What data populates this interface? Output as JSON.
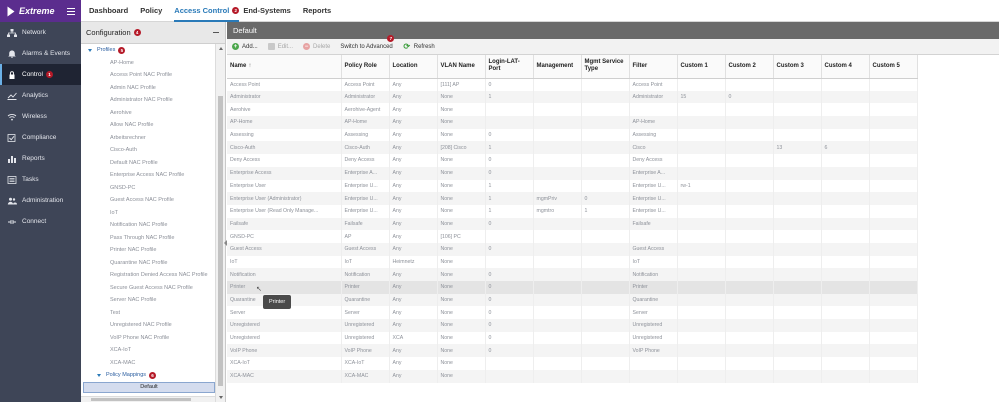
{
  "brand": {
    "name": "Extreme"
  },
  "sidebar": {
    "items": [
      {
        "label": "Network",
        "icon": "network-icon"
      },
      {
        "label": "Alarms & Events",
        "icon": "bell-icon"
      },
      {
        "label": "Control",
        "icon": "lock-icon",
        "badge": "1",
        "active": true
      },
      {
        "label": "Analytics",
        "icon": "chart-icon"
      },
      {
        "label": "Wireless",
        "icon": "wifi-icon"
      },
      {
        "label": "Compliance",
        "icon": "checkmark-icon"
      },
      {
        "label": "Reports",
        "icon": "bar-chart-icon"
      },
      {
        "label": "Tasks",
        "icon": "list-icon"
      },
      {
        "label": "Administration",
        "icon": "users-icon"
      },
      {
        "label": "Connect",
        "icon": "connect-icon"
      }
    ]
  },
  "topnav": {
    "tabs": [
      {
        "label": "Dashboard"
      },
      {
        "label": "Policy"
      },
      {
        "label": "Access Control",
        "active": true,
        "badge": "2"
      },
      {
        "label": "End-Systems"
      },
      {
        "label": "Reports"
      }
    ]
  },
  "tree": {
    "header": "Configuration",
    "header_badge": "4",
    "profiles_label": "Profiles",
    "profiles_badge": "5",
    "profiles": [
      "AP-Home",
      "Access Point NAC Profile",
      "Admin NAC Profile",
      "Administrator NAC Profile",
      "Aerohive",
      "Allow NAC Profile",
      "Arbeitsrechner",
      "Cisco-Auth",
      "Default NAC Profile",
      "Enterprise Access NAC Profile",
      "GNSD-PC",
      "Guest Access NAC Profile",
      "IoT",
      "Notification NAC Profile",
      "Pass Through NAC Profile",
      "Printer NAC Profile",
      "Quarantine NAC Profile",
      "Registration Denied Access NAC Profile",
      "Secure Guest Access NAC Profile",
      "Server NAC Profile",
      "Test",
      "Unregistered NAC Profile",
      "VoIP Phone NAC Profile",
      "XCA-IoT",
      "XCA-MAC"
    ],
    "mappings_label": "Policy Mappings",
    "mappings_badge": "6",
    "selected": "Default"
  },
  "main": {
    "title": "Default",
    "toolbar": {
      "add": "Add...",
      "edit": "Edit...",
      "delete": "Delete",
      "switch": "Switch to Advanced",
      "switch_badge": "7",
      "refresh": "Refresh"
    },
    "columns": [
      "Name",
      "Policy Role",
      "Location",
      "VLAN Name",
      "Login-LAT-Port",
      "Management",
      "Mgmt Service Type",
      "Filter",
      "Custom 1",
      "Custom 2",
      "Custom 3",
      "Custom 4",
      "Custom 5"
    ],
    "sort_indicator": "↑",
    "rows": [
      [
        "Access Point",
        "Access Point",
        "Any",
        "[111] AP",
        "0",
        "",
        "",
        "Access Point",
        "",
        "",
        "",
        "",
        ""
      ],
      [
        "Administrator",
        "Administrator",
        "Any",
        "None",
        "1",
        "",
        "",
        "Administrator",
        "15",
        "0",
        "",
        "",
        ""
      ],
      [
        "Aerohive",
        "Aerohive-Agent",
        "Any",
        "None",
        "",
        "",
        "",
        "",
        "",
        "",
        "",
        "",
        ""
      ],
      [
        "AP-Home",
        "AP-Home",
        "Any",
        "None",
        "",
        "",
        "",
        "AP-Home",
        "",
        "",
        "",
        "",
        ""
      ],
      [
        "Assessing",
        "Assessing",
        "Any",
        "None",
        "0",
        "",
        "",
        "Assessing",
        "",
        "",
        "",
        "",
        ""
      ],
      [
        "Cisco-Auth",
        "Cisco-Auth",
        "Any",
        "[208] Cisco",
        "1",
        "",
        "",
        "Cisco",
        "",
        "",
        "13",
        "6",
        ""
      ],
      [
        "Deny Access",
        "Deny Access",
        "Any",
        "None",
        "0",
        "",
        "",
        "Deny Access",
        "",
        "",
        "",
        "",
        ""
      ],
      [
        "Enterprise Access",
        "Enterprise A...",
        "Any",
        "None",
        "0",
        "",
        "",
        "Enterprise A...",
        "",
        "",
        "",
        "",
        ""
      ],
      [
        "Enterprise User",
        "Enterprise U...",
        "Any",
        "None",
        "1",
        "",
        "",
        "Enterprise U...",
        "rw-1",
        "",
        "",
        "",
        ""
      ],
      [
        "Enterprise User (Administrator)",
        "Enterprise U...",
        "Any",
        "None",
        "1",
        "mgmPriv",
        "0",
        "Enterprise U...",
        "",
        "",
        "",
        "",
        ""
      ],
      [
        "Enterprise User (Read Only Manage...",
        "Enterprise U...",
        "Any",
        "None",
        "1",
        "mgmtro",
        "1",
        "Enterprise U...",
        "",
        "",
        "",
        "",
        ""
      ],
      [
        "Failsafe",
        "Failsafe",
        "Any",
        "None",
        "0",
        "",
        "",
        "Failsafe",
        "",
        "",
        "",
        "",
        ""
      ],
      [
        "GNSD-PC",
        "AP",
        "Any",
        "[106] PC",
        "",
        "",
        "",
        "",
        "",
        "",
        "",
        "",
        ""
      ],
      [
        "Guest Access",
        "Guest Access",
        "Any",
        "None",
        "0",
        "",
        "",
        "Guest Access",
        "",
        "",
        "",
        "",
        ""
      ],
      [
        "IoT",
        "IoT",
        "Heimnetz",
        "None",
        "",
        "",
        "",
        "IoT",
        "",
        "",
        "",
        "",
        ""
      ],
      [
        "Notification",
        "Notification",
        "Any",
        "None",
        "0",
        "",
        "",
        "Notification",
        "",
        "",
        "",
        "",
        ""
      ],
      [
        "Printer",
        "Printer",
        "Any",
        "None",
        "0",
        "",
        "",
        "Printer",
        "",
        "",
        "",
        "",
        ""
      ],
      [
        "Quarantine",
        "Quarantine",
        "Any",
        "None",
        "0",
        "",
        "",
        "Quarantine",
        "",
        "",
        "",
        "",
        ""
      ],
      [
        "Server",
        "Server",
        "Any",
        "None",
        "0",
        "",
        "",
        "Server",
        "",
        "",
        "",
        "",
        ""
      ],
      [
        "Unregistered",
        "Unregistered",
        "Any",
        "None",
        "0",
        "",
        "",
        "Unregistered",
        "",
        "",
        "",
        "",
        ""
      ],
      [
        "Unregistered",
        "Unregistered",
        "XCA",
        "None",
        "0",
        "",
        "",
        "Unregistered",
        "",
        "",
        "",
        "",
        ""
      ],
      [
        "VoIP Phone",
        "VoIP Phone",
        "Any",
        "None",
        "0",
        "",
        "",
        "VoIP Phone",
        "",
        "",
        "",
        "",
        ""
      ],
      [
        "XCA-IoT",
        "XCA-IoT",
        "Any",
        "None",
        "",
        "",
        "",
        "",
        "",
        "",
        "",
        "",
        ""
      ],
      [
        "XCA-MAC",
        "XCA-MAC",
        "Any",
        "None",
        "",
        "",
        "",
        "",
        "",
        "",
        "",
        "",
        ""
      ]
    ],
    "tooltip": "Printer"
  },
  "colors": {
    "sidebar_bg": "#3e4557",
    "brand_bg": "#5b2d8e",
    "accent": "#2a7ab8",
    "badge": "#b51a28"
  }
}
